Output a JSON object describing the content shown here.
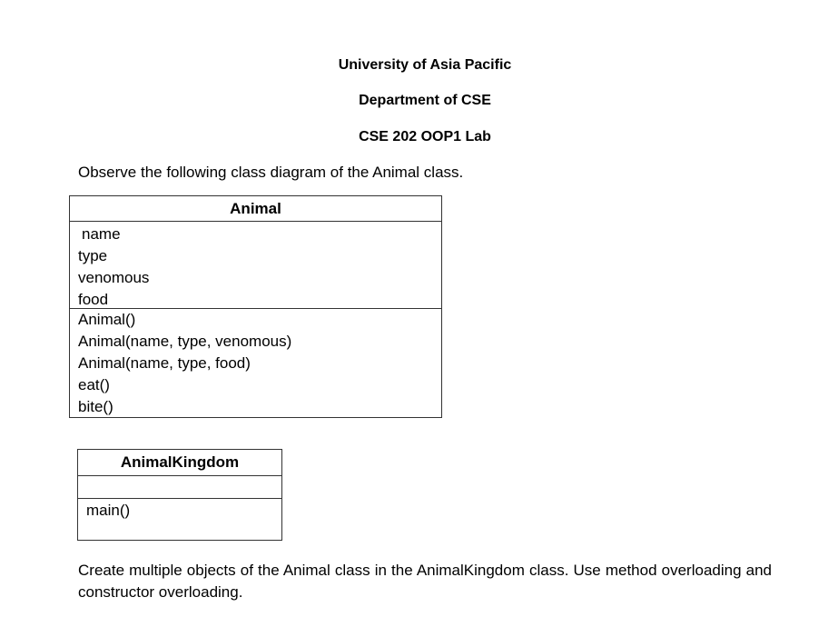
{
  "header": {
    "university": "University of Asia Pacific",
    "department": "Department of CSE",
    "course": "CSE 202 OOP1 Lab"
  },
  "intro_text": "Observe the following class diagram of the Animal class.",
  "animal_class": {
    "name": "Animal",
    "attributes": [
      "name",
      "type",
      "venomous",
      "food"
    ],
    "methods": [
      "Animal()",
      "Animal(name, type, venomous)",
      "Animal(name, type, food)",
      "eat()",
      "bite()"
    ]
  },
  "kingdom_class": {
    "name": "AnimalKingdom",
    "attributes": [],
    "methods": [
      "main()"
    ]
  },
  "task_text": "Create multiple objects of the Animal class in the AnimalKingdom class. Use method overloading and constructor overloading."
}
